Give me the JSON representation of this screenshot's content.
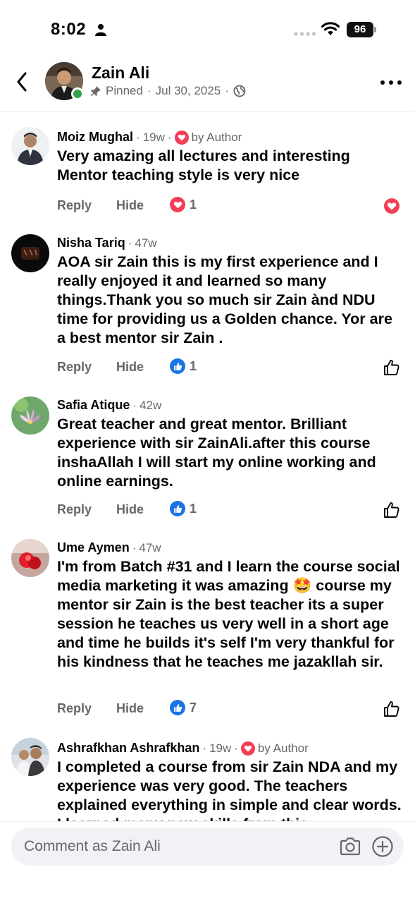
{
  "status_bar": {
    "time": "8:02",
    "battery": "96"
  },
  "header": {
    "name": "Zain Ali",
    "pinned": "Pinned",
    "dot1": "·",
    "date": "Jul 30, 2025",
    "dot2": "·"
  },
  "comments": [
    {
      "name": "Moiz Mughal",
      "time": "19w",
      "badge": "by Author",
      "text": "Very amazing all lectures and interesting Mentor teaching style is very nice",
      "reply": "Reply",
      "hide": "Hide",
      "reaction_type": "love",
      "reaction_count": "1"
    },
    {
      "name": "Nisha Tariq",
      "time": "47w",
      "text": "AOA sir Zain this is my first experience and I really enjoyed it and learned so many things.Thank you so much sir Zain ànd NDU time for providing us a Golden chance. Yor are a best mentor sir Zain .",
      "reply": "Reply",
      "hide": "Hide",
      "reaction_type": "like",
      "reaction_count": "1"
    },
    {
      "name": "Safia Atique",
      "time": "42w",
      "text": "Great  teacher and great mentor. Brilliant experience with sir ZainAli.after this course inshaAllah I will start my online working and online earnings.",
      "reply": "Reply",
      "hide": "Hide",
      "reaction_type": "like",
      "reaction_count": "1"
    },
    {
      "name": "Ume Aymen",
      "time": "47w",
      "text": "I'm from Batch #31 and I learn the course social media marketing it was amazing 🤩 course my mentor sir Zain is the best teacher its a super session he teaches us very well in a short age and time he builds it's self I'm very thankful for his kindness that he teaches me jazakllah sir.",
      "reply": "Reply",
      "hide": "Hide",
      "reaction_type": "like",
      "reaction_count": "7"
    },
    {
      "name": "Ashrafkhan Ashrafkhan",
      "time": "19w",
      "badge": "by Author",
      "text": "I completed a course from sir Zain NDA and my experience was very good. The teachers explained everything in simple and clear words. I learned many new skills from this"
    }
  ],
  "composer": {
    "placeholder": "Comment as Zain Ali"
  },
  "colors": {
    "accent": "#1b74e4",
    "love": "#f33e58",
    "online": "#31a24c",
    "muted": "#65676b"
  },
  "icons": [
    "back-arrow-icon",
    "pin-icon",
    "globe-icon",
    "more-icon",
    "heart-icon",
    "like-icon",
    "thumbs-up-outline-icon",
    "camera-icon",
    "add-circle-icon"
  ]
}
